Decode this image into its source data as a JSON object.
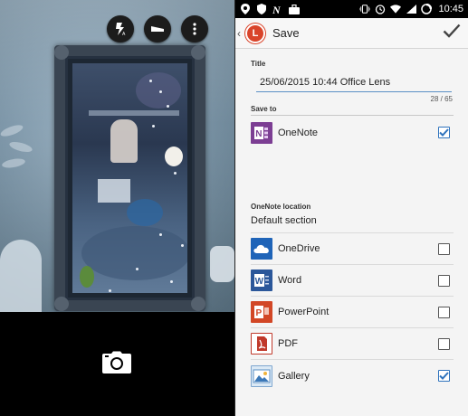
{
  "status_bar": {
    "time": "10:45"
  },
  "toolbar": {
    "title": "Save",
    "logo_text": "L",
    "confirm_icon": "checkmark-icon"
  },
  "camera": {
    "buttons": [
      "flash-auto-icon",
      "document-mode-icon",
      "more-vert-icon"
    ],
    "shutter_icon": "camera-icon"
  },
  "form": {
    "title_label": "Title",
    "title_value": "25/06/2015 10:44 Office Lens",
    "char_count": "28 / 65",
    "save_to_label": "Save to",
    "location_label": "OneNote location",
    "location_value": "Default section"
  },
  "destinations": [
    {
      "label": "OneNote",
      "icon": "onenote-icon",
      "checked": true
    },
    {
      "label": "OneDrive",
      "icon": "onedrive-icon",
      "checked": false
    },
    {
      "label": "Word",
      "icon": "word-icon",
      "checked": false
    },
    {
      "label": "PowerPoint",
      "icon": "powerpoint-icon",
      "checked": false
    },
    {
      "label": "PDF",
      "icon": "pdf-icon",
      "checked": false
    },
    {
      "label": "Gallery",
      "icon": "gallery-icon",
      "checked": true
    }
  ],
  "colors": {
    "accent": "#2f73bd",
    "onenote": "#7c3e93",
    "onedrive": "#1f64b8",
    "word": "#2b579a",
    "powerpoint": "#d24726",
    "pdf": "#c0392b",
    "logo": "#d9442a"
  }
}
